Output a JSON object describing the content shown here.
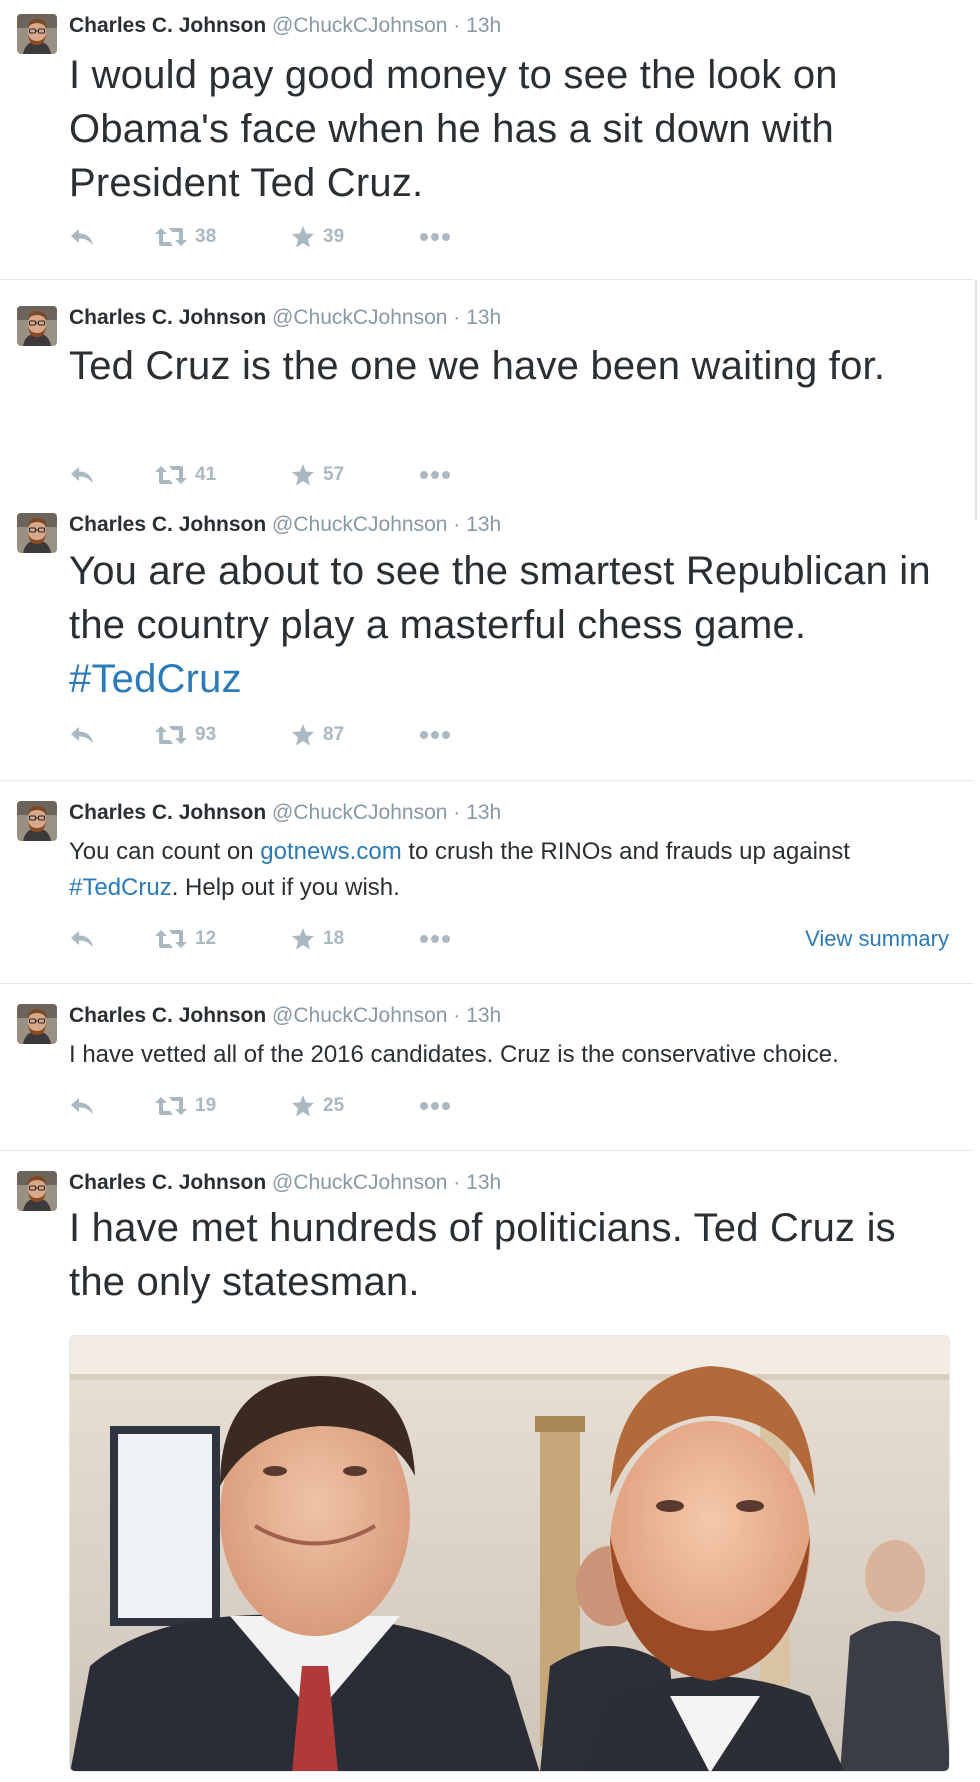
{
  "user": {
    "fullname": "Charles C. Johnson",
    "username": "@ChuckCJohnson",
    "dot": "·"
  },
  "tweets": [
    {
      "time": "13h",
      "text": "I would pay good money to see the look on Obama's face when he has a sit down with President Ted Cruz.",
      "retweets": "38",
      "favorites": "39"
    },
    {
      "time": "13h",
      "text": "Ted Cruz is the one we have been waiting for.",
      "retweets": "41",
      "favorites": "57"
    },
    {
      "time": "13h",
      "text_before": "You are about to see the smartest Republican in the country play a masterful chess game. ",
      "hashtag": "#TedCruz",
      "retweets": "93",
      "favorites": "87"
    },
    {
      "time": "13h",
      "text_a": "You can count on ",
      "link": "gotnews.com",
      "text_b": " to crush the RINOs and frauds up against ",
      "hashtag": "#TedCruz",
      "text_c": ". Help out if you wish.",
      "retweets": "12",
      "favorites": "18",
      "view_summary": "View summary"
    },
    {
      "time": "13h",
      "text": "I have vetted all of the 2016 candidates. Cruz is the conservative choice.",
      "retweets": "19",
      "favorites": "25"
    },
    {
      "time": "13h",
      "text": "I have met hundreds of politicians. Ted Cruz is the only statesman."
    }
  ],
  "colors": {
    "text": "#292f33",
    "muted": "#8899a6",
    "icon": "#aab8c2",
    "link": "#2b7bb9",
    "divider": "#e1e8ed"
  },
  "icons": [
    "avatar",
    "reply-icon",
    "retweet-icon",
    "favorite-star-icon",
    "more-dots-icon"
  ]
}
